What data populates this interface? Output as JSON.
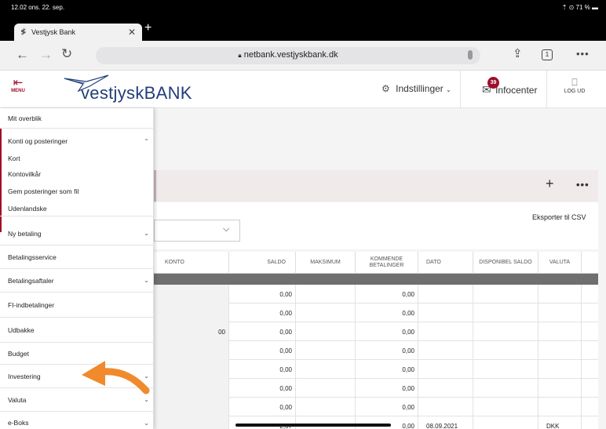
{
  "status_bar": {
    "time": "12.02  ons. 22. sep.",
    "right": "⇡ ⊙ 71 % ▬"
  },
  "browser": {
    "tab_title": "Vestjysk Bank",
    "url": "netbank.vestjyskbank.dk",
    "tab_count": "1"
  },
  "header": {
    "menu_label": "MENU",
    "logo_text_1": "vestjysk",
    "logo_text_2": "BANK",
    "settings_label": "Indstillinger",
    "info_label": "Infocenter",
    "info_badge": "39",
    "logout_label": "LOG UD"
  },
  "sidemenu": {
    "items": [
      {
        "label": "Mit overblik"
      },
      {
        "label": "Konti og posteringer",
        "expanded": true
      },
      {
        "label": "Ny betaling"
      },
      {
        "label": "Betalingsservice"
      },
      {
        "label": "Betalingsaftaler"
      },
      {
        "label": "FI-indbetalinger"
      },
      {
        "label": "Udbakke"
      },
      {
        "label": "Budget"
      },
      {
        "label": "Investering"
      },
      {
        "label": "Valuta"
      },
      {
        "label": "e-Boks"
      }
    ],
    "subitems": [
      "Kort",
      "Kontovilkår",
      "Gem posteringer som fil",
      "Udenlandske"
    ]
  },
  "main": {
    "export_label": "Eksporter til CSV",
    "table": {
      "headers": [
        "KONTO",
        "SALDO",
        "MAKSIMUM",
        "KOMMENDE BETALINGER",
        "DATO",
        "DISPONIBEL SALDO",
        "VALUTA"
      ],
      "rows": [
        {
          "konto": "",
          "saldo": "0,00",
          "kommende": "0,00",
          "dato": "",
          "valuta": ""
        },
        {
          "konto": "",
          "saldo": "0,00",
          "kommende": "0,00",
          "dato": "",
          "valuta": ""
        },
        {
          "konto": "00",
          "saldo": "0,00",
          "kommende": "0,00",
          "dato": "",
          "valuta": ""
        },
        {
          "konto": "",
          "saldo": "0,00",
          "kommende": "0,00",
          "dato": "",
          "valuta": ""
        },
        {
          "konto": "",
          "saldo": "0,00",
          "kommende": "0,00",
          "dato": "",
          "valuta": ""
        },
        {
          "konto": "",
          "saldo": "0,00",
          "kommende": "0,00",
          "dato": "",
          "valuta": ""
        },
        {
          "konto": "",
          "saldo": "0,00",
          "kommende": "0,00",
          "dato": "",
          "valuta": ""
        },
        {
          "konto": "",
          "saldo": "2,37",
          "kommende": "0,00",
          "dato": "08.09.2021",
          "valuta": "DKK"
        }
      ]
    }
  },
  "colors": {
    "brand_red": "#a10d2a",
    "brand_blue": "#213e7a",
    "arrow_orange": "#f08a2c"
  }
}
